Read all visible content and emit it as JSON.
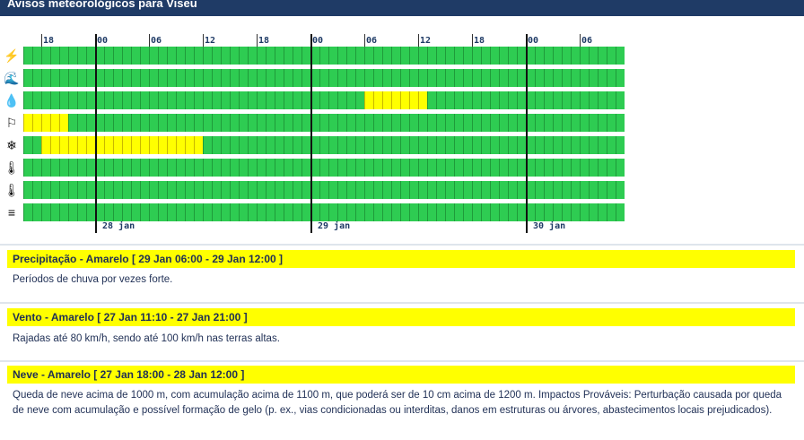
{
  "header": {
    "title": "Avisos meteorológicos para Viseu"
  },
  "timeline": {
    "hour_labels": [
      "18",
      "00",
      "06",
      "12",
      "18",
      "00",
      "06",
      "12",
      "18",
      "00",
      "06"
    ],
    "day_labels": [
      "28 jan",
      "29 jan",
      "30 jan"
    ],
    "rows": [
      {
        "icon": "lightning-icon",
        "symbol": "⚡",
        "yellow": []
      },
      {
        "icon": "coastal-wave-icon",
        "symbol": "🌊",
        "yellow": []
      },
      {
        "icon": "rain-drops-icon",
        "symbol": "💧",
        "yellow": [
          [
            38,
            44
          ]
        ]
      },
      {
        "icon": "wind-flag-icon",
        "symbol": "⚐",
        "yellow": [
          [
            0,
            4
          ]
        ]
      },
      {
        "icon": "snowflake-icon",
        "symbol": "❄",
        "yellow": [
          [
            2,
            19
          ]
        ]
      },
      {
        "icon": "thermometer-cold-icon",
        "symbol": "🌡",
        "yellow": []
      },
      {
        "icon": "thermometer-hot-icon",
        "symbol": "🌡",
        "yellow": []
      },
      {
        "icon": "fog-icon",
        "symbol": "≡",
        "yellow": []
      }
    ]
  },
  "warnings": [
    {
      "title": "Precipitação - Amarelo [ 29 Jan 06:00 - 29 Jan 12:00 ]",
      "text": "Períodos de chuva por vezes forte."
    },
    {
      "title": "Vento - Amarelo [ 27 Jan 11:10 - 27 Jan 21:00 ]",
      "text": "Rajadas até 80 km/h, sendo até 100 km/h nas terras altas."
    },
    {
      "title": "Neve - Amarelo [ 27 Jan 18:00 - 28 Jan 12:00 ]",
      "text": "Queda de neve acima de 1000 m, com acumulação acima de 1100 m, que poderá ser de 10 cm acima de 1200 m. Impactos Prováveis: Perturbação causada por queda de neve com acumulação e possível formação de gelo (p. ex., vias condicionadas ou interditas, danos em estruturas ou árvores, abastecimentos locais prejudicados)."
    }
  ]
}
